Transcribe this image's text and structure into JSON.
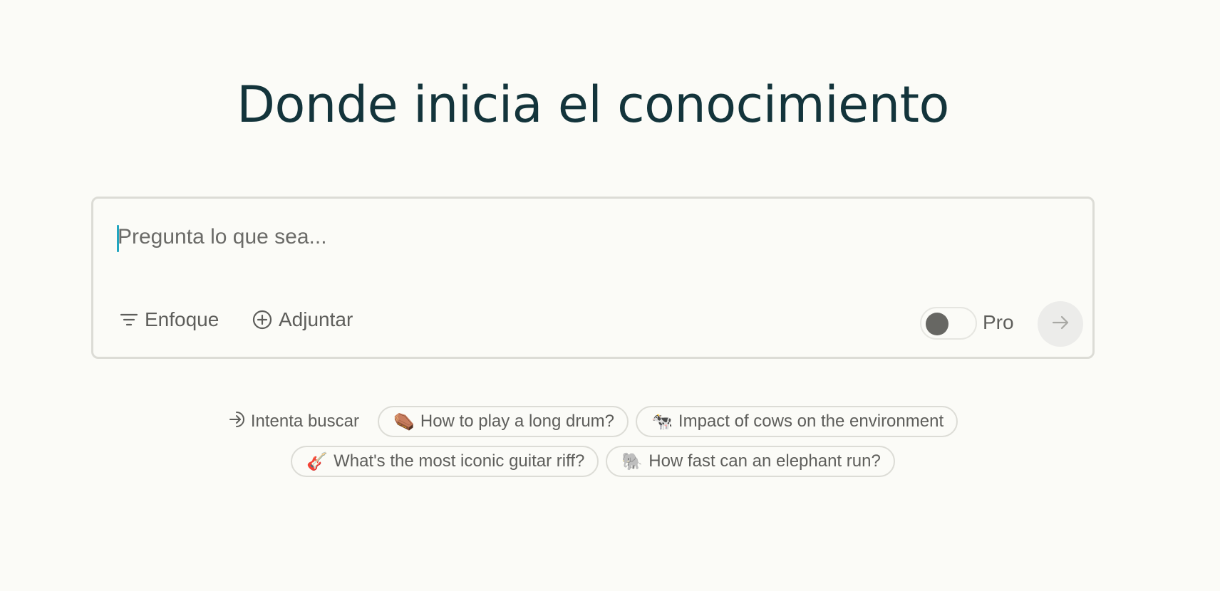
{
  "headline": "Donde inicia el conocimiento",
  "search": {
    "placeholder": "Pregunta lo que sea...",
    "value": ""
  },
  "toolbar": {
    "focus_label": "Enfoque",
    "focus_icon": "filter-lines-icon",
    "attach_label": "Adjuntar",
    "attach_icon": "plus-circle-icon",
    "pro_label": "Pro",
    "pro_enabled": false,
    "submit_icon": "arrow-right-icon"
  },
  "suggestions": {
    "label": "Intenta buscar",
    "label_icon": "arrow-in-icon",
    "items": [
      {
        "emoji": "⚰️",
        "text": "How to play a long drum?"
      },
      {
        "emoji": "🐄",
        "text": "Impact of cows on the environment"
      },
      {
        "emoji": "🎸",
        "text": "What's the most iconic guitar riff?"
      },
      {
        "emoji": "🐘",
        "text": "How fast can an elephant run?"
      }
    ]
  },
  "colors": {
    "background": "#fbfbf7",
    "headline": "#13343b",
    "caret": "#22a6c0",
    "border": "#dcdcd6"
  }
}
